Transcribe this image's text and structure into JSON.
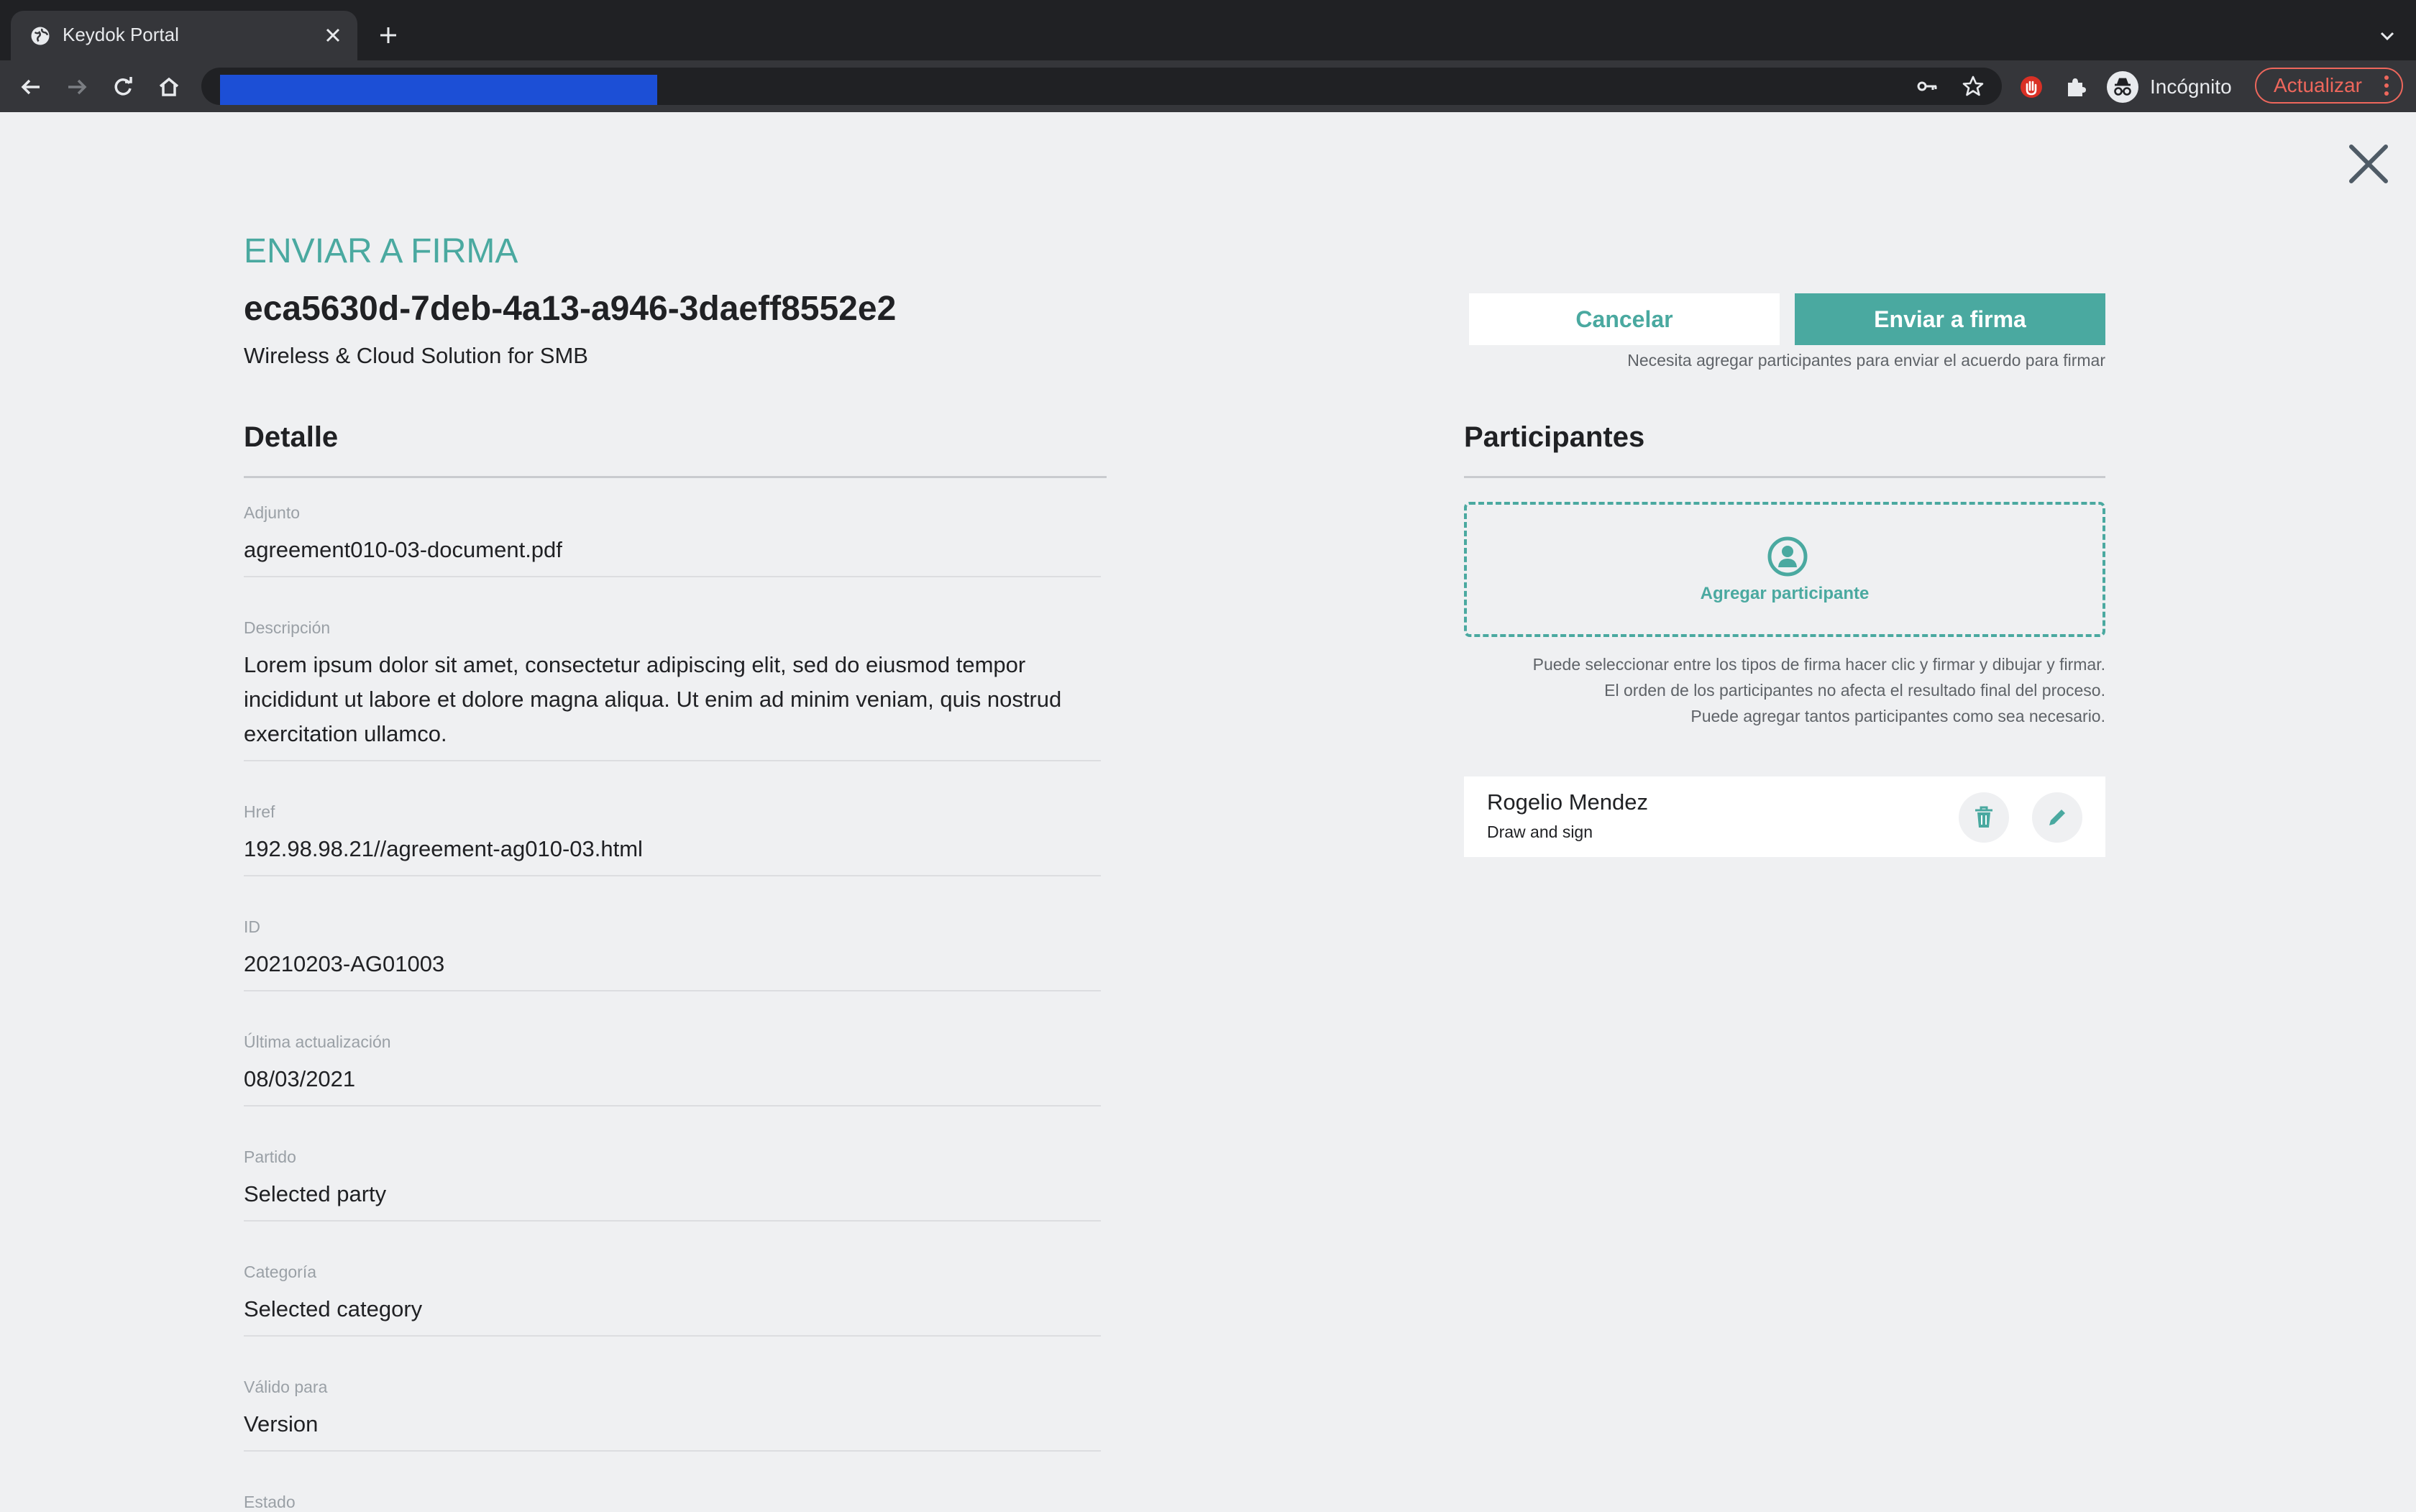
{
  "browser": {
    "tab_title": "Keydok Portal",
    "profile_label": "Incógnito",
    "update_label": "Actualizar",
    "icons": [
      "globe-icon",
      "close-icon",
      "plus-icon",
      "chevron-down-icon",
      "back-icon",
      "forward-icon",
      "reload-icon",
      "home-icon",
      "key-icon",
      "star-icon",
      "extension-icon",
      "puzzle-icon",
      "incognito-icon",
      "more-vert-icon"
    ]
  },
  "header": {
    "eyebrow": "ENVIAR A FIRMA",
    "doc_id": "eca5630d-7deb-4a13-a946-3daeff8552e2",
    "subtitle": "Wireless & Cloud Solution for SMB",
    "cancel_label": "Cancelar",
    "send_label": "Enviar a firma",
    "send_hint": "Necesita agregar participantes para enviar el acuerdo para firmar"
  },
  "detail": {
    "title": "Detalle",
    "fields": [
      {
        "label": "Adjunto",
        "value": "agreement010-03-document.pdf"
      },
      {
        "label": "Descripción",
        "value": "Lorem ipsum dolor sit amet, consectetur adipiscing elit, sed do eiusmod tempor incididunt ut labore et dolore magna aliqua. Ut enim ad minim veniam, quis nostrud exercitation ullamco."
      },
      {
        "label": "Href",
        "value": "192.98.98.21//agreement-ag010-03.html"
      },
      {
        "label": "ID",
        "value": "20210203-AG01003"
      },
      {
        "label": "Última actualización",
        "value": "08/03/2021"
      },
      {
        "label": "Partido",
        "value": "Selected party"
      },
      {
        "label": "Categoría",
        "value": "Selected category"
      },
      {
        "label": "Válido para",
        "value": "Version"
      },
      {
        "label": "Estado",
        "value": ""
      }
    ]
  },
  "participants": {
    "title": "Participantes",
    "add_label": "Agregar participante",
    "help": [
      "Puede seleccionar entre los tipos de firma hacer clic y firmar y dibujar y firmar.",
      "El orden de los participantes no afecta el resultado final del proceso.",
      "Puede agregar tantos participantes como sea necesario."
    ],
    "items": [
      {
        "name": "Rogelio Mendez",
        "type": "Draw and sign"
      }
    ]
  },
  "colors": {
    "accent": "#4aa9a0",
    "page_bg": "#eff0f2",
    "chrome_dark": "#202124",
    "chrome_toolbar": "#35363a",
    "update_red": "#ee675c"
  }
}
